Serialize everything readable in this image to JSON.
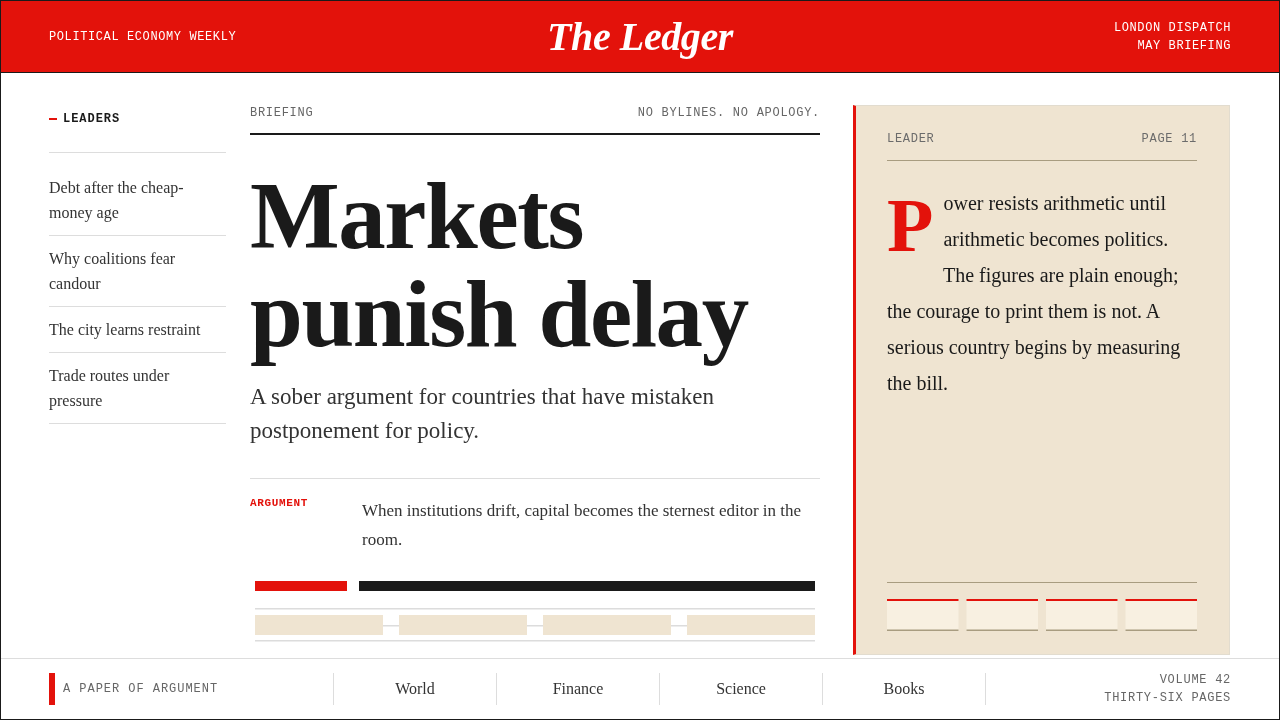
{
  "masthead": {
    "tagline": "POLITICAL ECONOMY WEEKLY",
    "title": "The Ledger",
    "edition_lines": [
      "LONDON DISPATCH",
      "MAY BRIEFING"
    ]
  },
  "sidebar": {
    "heading": "LEADERS",
    "items": [
      "Debt after the cheap-money age",
      "Why coalitions fear candour",
      "The city learns restraint",
      "Trade routes under pressure"
    ]
  },
  "article": {
    "section": "BRIEFING",
    "motto": "NO BYLINES. NO APOLOGY.",
    "headline": "Markets punish delay",
    "dek": "A sober argument for countries that have mistaken postponement for policy.",
    "argument": {
      "label": "ARGUMENT",
      "text": "When institutions drift, capital becomes the sternest editor in the room."
    }
  },
  "leader_card": {
    "label": "LEADER",
    "page": "PAGE 11",
    "drop_cap": "P",
    "paragraphs": [
      "ower resists arithmetic until arithmetic becomes politics.",
      "The figures are plain enough; the courage to print them is not. A serious country begins by measuring the bill."
    ]
  },
  "footer": {
    "motto": "A PAPER OF ARGUMENT",
    "nav": [
      "World",
      "Finance",
      "Science",
      "Books"
    ],
    "volume_lines": [
      "VOLUME 42",
      "THIRTY-SIX PAGES"
    ]
  }
}
